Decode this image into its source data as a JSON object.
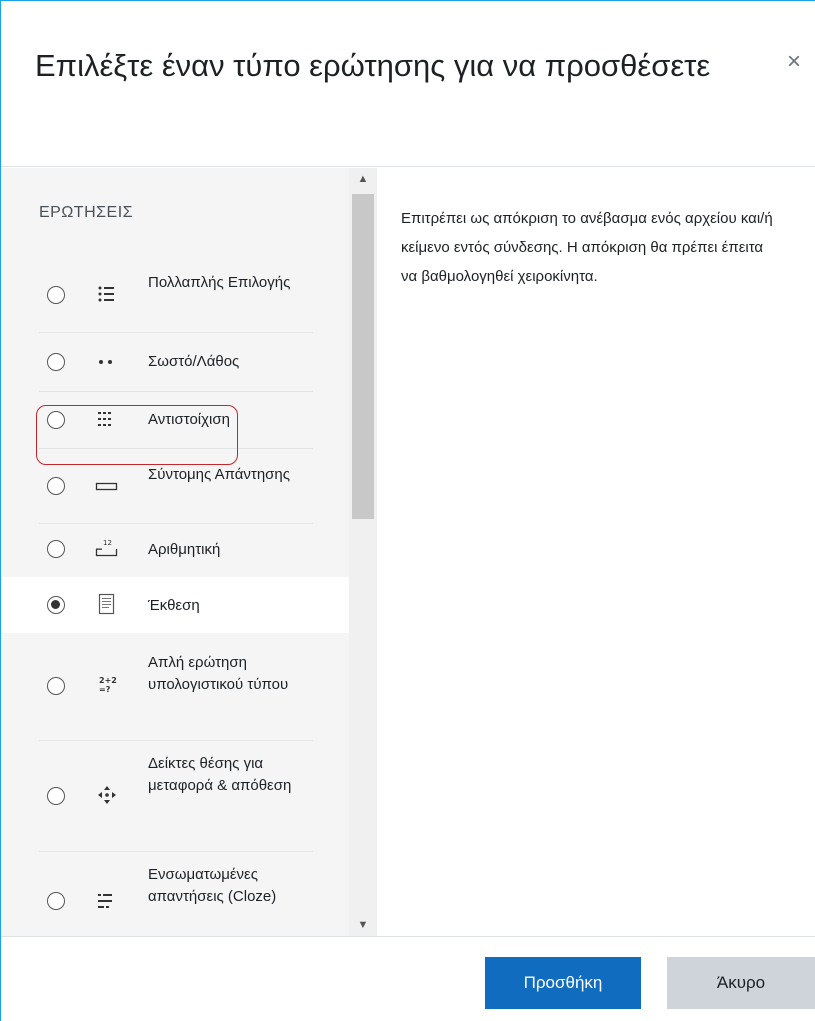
{
  "dialog": {
    "title": "Επιλέξτε έναν τύπο ερώτησης για να προσθέσετε",
    "close_label": "×"
  },
  "sidebar": {
    "section_label": "ΕΡΩΤΗΣΕΙΣ",
    "items": [
      {
        "label": "Πολλαπλής Επιλογής",
        "icon": "multiple-choice-icon",
        "selected": false
      },
      {
        "label": "Σωστό/Λάθος",
        "icon": "true-false-icon",
        "selected": false
      },
      {
        "label": "Αντιστοίχιση",
        "icon": "matching-icon",
        "selected": false
      },
      {
        "label": "Σύντομης Απάντησης",
        "icon": "short-answer-icon",
        "selected": false
      },
      {
        "label": "Αριθμητική",
        "icon": "numerical-icon",
        "selected": false
      },
      {
        "label": "Έκθεση",
        "icon": "essay-icon",
        "selected": true
      },
      {
        "label": "Απλή ερώτηση υπολογιστικού τύπου",
        "icon": "calculated-simple-icon",
        "selected": false
      },
      {
        "label": "Δείκτες θέσης για μεταφορά & απόθεση",
        "icon": "drag-drop-markers-icon",
        "selected": false
      },
      {
        "label": "Ενσωματωμένες απαντήσεις (Cloze)",
        "icon": "cloze-icon",
        "selected": false
      }
    ]
  },
  "description": "Επιτρέπει ως απόκριση το ανέβασμα ενός αρχείου και/ή κείμενο εντός σύνδεσης. Η απόκριση θα πρέπει έπειτα να βαθμολογηθεί χειροκίνητα.",
  "footer": {
    "add_label": "Προσθήκη",
    "cancel_label": "Άκυρο"
  },
  "colors": {
    "accent": "#0f6cbf",
    "highlight": "#c4262e",
    "window_border": "#1aa3e8"
  }
}
